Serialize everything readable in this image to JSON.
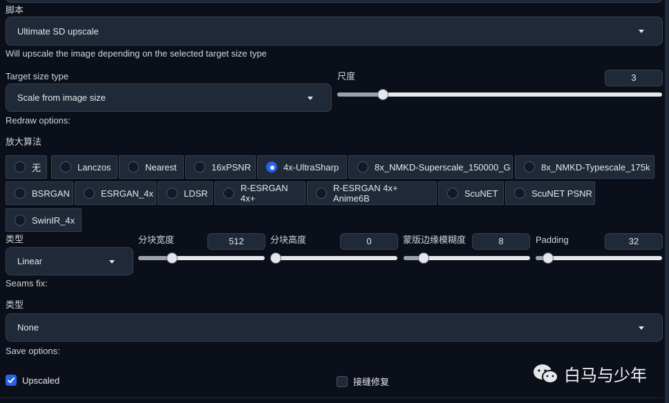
{
  "script": {
    "label": "脚本",
    "value": "Ultimate SD upscale",
    "description": "Will upscale the image depending on the selected target size type"
  },
  "target_size": {
    "label": "Target size type",
    "value": "Scale from image size"
  },
  "scale": {
    "label": "尺度",
    "value": "3",
    "fraction": 0.14
  },
  "redraw_options_label": "Redraw options:",
  "upscaler": {
    "label": "放大算法",
    "options": [
      "无",
      "Lanczos",
      "Nearest",
      "16xPSNR",
      "4x-UltraSharp",
      "8x_NMKD-Superscale_150000_G",
      "8x_NMKD-Typescale_175k",
      "BSRGAN",
      "ESRGAN_4x",
      "LDSR",
      "R-ESRGAN 4x+",
      "R-ESRGAN 4x+ Anime6B",
      "ScuNET",
      "ScuNET PSNR",
      "SwinIR_4x"
    ],
    "selected": "4x-UltraSharp"
  },
  "type": {
    "label": "类型",
    "value": "Linear"
  },
  "tile_width": {
    "label": "分块宽度",
    "value": "512",
    "fraction": 0.27
  },
  "tile_height": {
    "label": "分块高度",
    "value": "0",
    "fraction": 0.0
  },
  "mask_blur": {
    "label": "蒙版边缘模糊度",
    "value": "8",
    "fraction": 0.16
  },
  "padding": {
    "label": "Padding",
    "value": "32",
    "fraction": 0.1
  },
  "seams_fix": {
    "label": "Seams fix:",
    "type_label": "类型",
    "value": "None"
  },
  "save_options": {
    "label": "Save options:",
    "upscaled": {
      "label": "Upscaled",
      "checked": true
    },
    "seams_fix": {
      "label": "接缝修复",
      "checked": false
    }
  },
  "watermark": {
    "text": "白马与少年"
  },
  "colors": {
    "accent": "#2563eb",
    "background": "#0b0f19",
    "panel": "#1f2937",
    "border": "#374151"
  }
}
